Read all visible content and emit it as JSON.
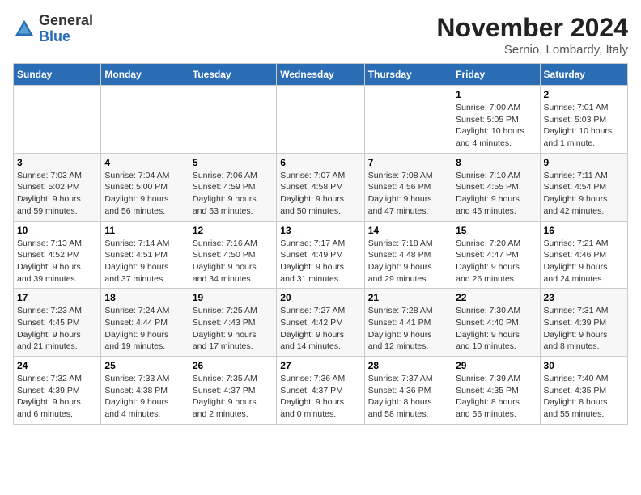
{
  "logo": {
    "general": "General",
    "blue": "Blue"
  },
  "header": {
    "month": "November 2024",
    "location": "Sernio, Lombardy, Italy"
  },
  "weekdays": [
    "Sunday",
    "Monday",
    "Tuesday",
    "Wednesday",
    "Thursday",
    "Friday",
    "Saturday"
  ],
  "weeks": [
    [
      {
        "day": "",
        "info": ""
      },
      {
        "day": "",
        "info": ""
      },
      {
        "day": "",
        "info": ""
      },
      {
        "day": "",
        "info": ""
      },
      {
        "day": "",
        "info": ""
      },
      {
        "day": "1",
        "info": "Sunrise: 7:00 AM\nSunset: 5:05 PM\nDaylight: 10 hours\nand 4 minutes."
      },
      {
        "day": "2",
        "info": "Sunrise: 7:01 AM\nSunset: 5:03 PM\nDaylight: 10 hours\nand 1 minute."
      }
    ],
    [
      {
        "day": "3",
        "info": "Sunrise: 7:03 AM\nSunset: 5:02 PM\nDaylight: 9 hours\nand 59 minutes."
      },
      {
        "day": "4",
        "info": "Sunrise: 7:04 AM\nSunset: 5:00 PM\nDaylight: 9 hours\nand 56 minutes."
      },
      {
        "day": "5",
        "info": "Sunrise: 7:06 AM\nSunset: 4:59 PM\nDaylight: 9 hours\nand 53 minutes."
      },
      {
        "day": "6",
        "info": "Sunrise: 7:07 AM\nSunset: 4:58 PM\nDaylight: 9 hours\nand 50 minutes."
      },
      {
        "day": "7",
        "info": "Sunrise: 7:08 AM\nSunset: 4:56 PM\nDaylight: 9 hours\nand 47 minutes."
      },
      {
        "day": "8",
        "info": "Sunrise: 7:10 AM\nSunset: 4:55 PM\nDaylight: 9 hours\nand 45 minutes."
      },
      {
        "day": "9",
        "info": "Sunrise: 7:11 AM\nSunset: 4:54 PM\nDaylight: 9 hours\nand 42 minutes."
      }
    ],
    [
      {
        "day": "10",
        "info": "Sunrise: 7:13 AM\nSunset: 4:52 PM\nDaylight: 9 hours\nand 39 minutes."
      },
      {
        "day": "11",
        "info": "Sunrise: 7:14 AM\nSunset: 4:51 PM\nDaylight: 9 hours\nand 37 minutes."
      },
      {
        "day": "12",
        "info": "Sunrise: 7:16 AM\nSunset: 4:50 PM\nDaylight: 9 hours\nand 34 minutes."
      },
      {
        "day": "13",
        "info": "Sunrise: 7:17 AM\nSunset: 4:49 PM\nDaylight: 9 hours\nand 31 minutes."
      },
      {
        "day": "14",
        "info": "Sunrise: 7:18 AM\nSunset: 4:48 PM\nDaylight: 9 hours\nand 29 minutes."
      },
      {
        "day": "15",
        "info": "Sunrise: 7:20 AM\nSunset: 4:47 PM\nDaylight: 9 hours\nand 26 minutes."
      },
      {
        "day": "16",
        "info": "Sunrise: 7:21 AM\nSunset: 4:46 PM\nDaylight: 9 hours\nand 24 minutes."
      }
    ],
    [
      {
        "day": "17",
        "info": "Sunrise: 7:23 AM\nSunset: 4:45 PM\nDaylight: 9 hours\nand 21 minutes."
      },
      {
        "day": "18",
        "info": "Sunrise: 7:24 AM\nSunset: 4:44 PM\nDaylight: 9 hours\nand 19 minutes."
      },
      {
        "day": "19",
        "info": "Sunrise: 7:25 AM\nSunset: 4:43 PM\nDaylight: 9 hours\nand 17 minutes."
      },
      {
        "day": "20",
        "info": "Sunrise: 7:27 AM\nSunset: 4:42 PM\nDaylight: 9 hours\nand 14 minutes."
      },
      {
        "day": "21",
        "info": "Sunrise: 7:28 AM\nSunset: 4:41 PM\nDaylight: 9 hours\nand 12 minutes."
      },
      {
        "day": "22",
        "info": "Sunrise: 7:30 AM\nSunset: 4:40 PM\nDaylight: 9 hours\nand 10 minutes."
      },
      {
        "day": "23",
        "info": "Sunrise: 7:31 AM\nSunset: 4:39 PM\nDaylight: 9 hours\nand 8 minutes."
      }
    ],
    [
      {
        "day": "24",
        "info": "Sunrise: 7:32 AM\nSunset: 4:39 PM\nDaylight: 9 hours\nand 6 minutes."
      },
      {
        "day": "25",
        "info": "Sunrise: 7:33 AM\nSunset: 4:38 PM\nDaylight: 9 hours\nand 4 minutes."
      },
      {
        "day": "26",
        "info": "Sunrise: 7:35 AM\nSunset: 4:37 PM\nDaylight: 9 hours\nand 2 minutes."
      },
      {
        "day": "27",
        "info": "Sunrise: 7:36 AM\nSunset: 4:37 PM\nDaylight: 9 hours\nand 0 minutes."
      },
      {
        "day": "28",
        "info": "Sunrise: 7:37 AM\nSunset: 4:36 PM\nDaylight: 8 hours\nand 58 minutes."
      },
      {
        "day": "29",
        "info": "Sunrise: 7:39 AM\nSunset: 4:35 PM\nDaylight: 8 hours\nand 56 minutes."
      },
      {
        "day": "30",
        "info": "Sunrise: 7:40 AM\nSunset: 4:35 PM\nDaylight: 8 hours\nand 55 minutes."
      }
    ]
  ]
}
